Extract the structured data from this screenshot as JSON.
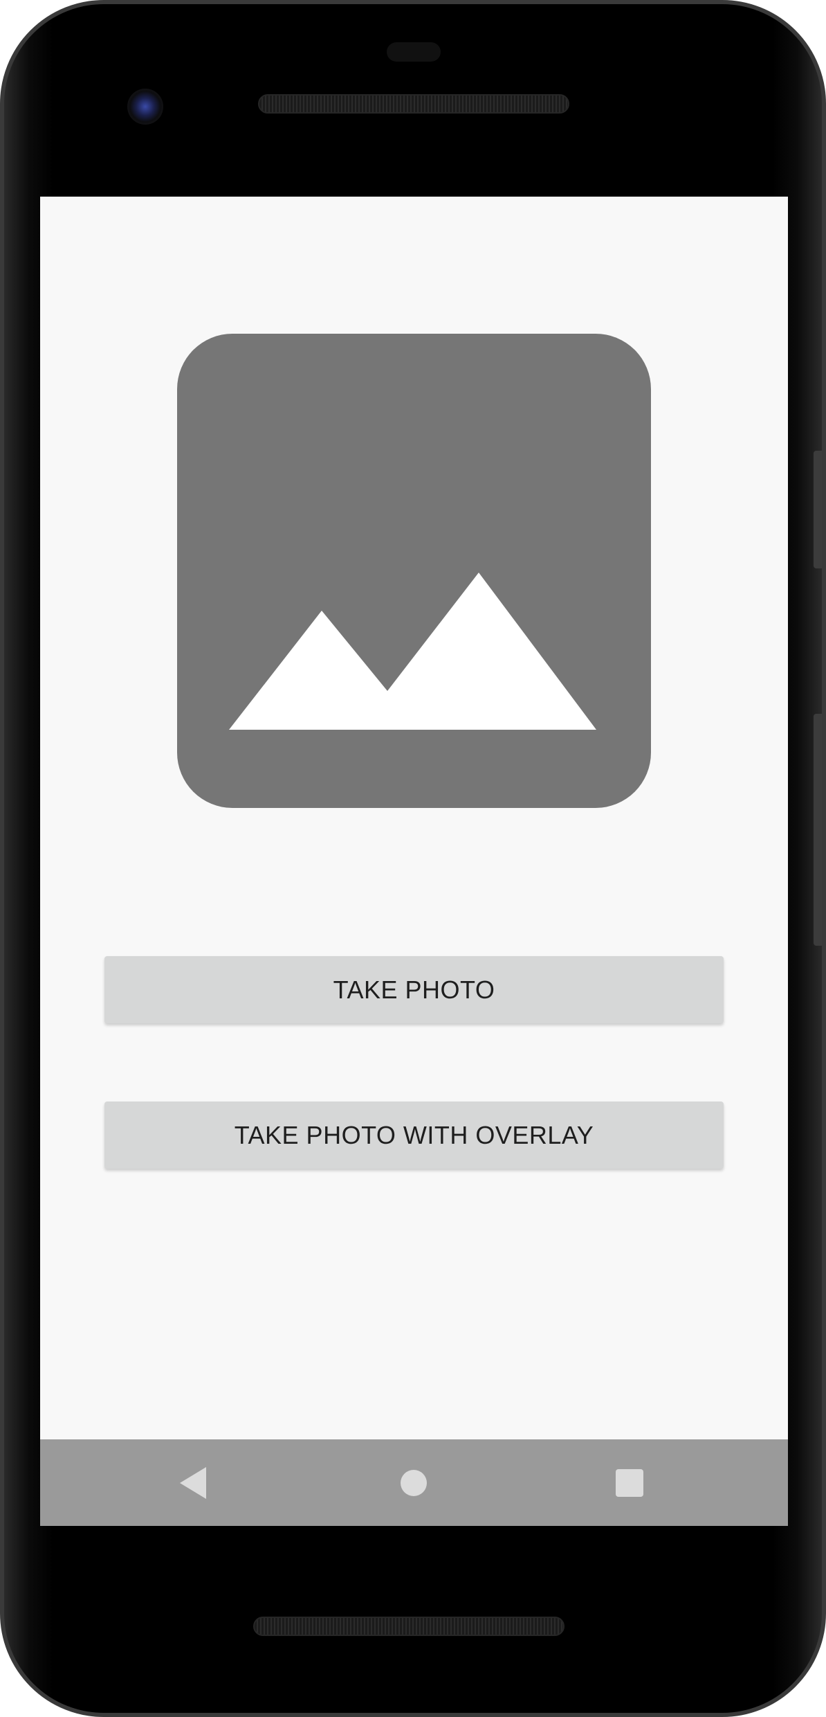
{
  "app": {
    "image_placeholder_icon": "image-icon",
    "take_photo_label": "TAKE PHOTO",
    "take_photo_overlay_label": "TAKE PHOTO WITH OVERLAY"
  },
  "nav_bar": {
    "back_icon": "back-triangle-icon",
    "home_icon": "home-circle-icon",
    "recents_icon": "recents-square-icon"
  },
  "colors": {
    "screen_background": "#f8f8f8",
    "placeholder_gray": "#767676",
    "button_background": "#d6d7d7",
    "button_text": "#1e1e1e",
    "nav_bar_background": "#9a9a9a",
    "nav_icon": "#dcdcdc"
  }
}
